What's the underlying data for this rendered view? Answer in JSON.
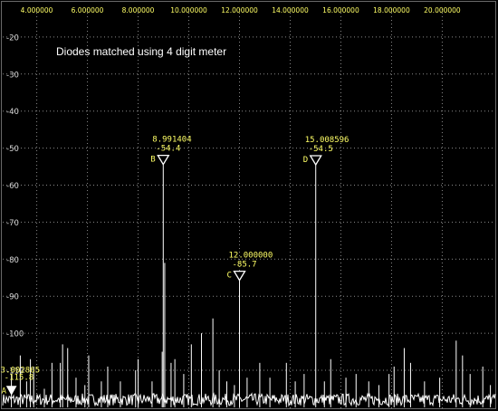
{
  "chart_data": {
    "type": "line",
    "title": "",
    "annotation": "Diodes matched using 4 digit meter",
    "xlabel": "",
    "ylabel": "",
    "xlim": [
      2.55,
      22.2
    ],
    "ylim": [
      -121,
      -10
    ],
    "x_ticks": [
      {
        "value": 4,
        "label": "4.000000"
      },
      {
        "value": 6,
        "label": "6.000000"
      },
      {
        "value": 8,
        "label": "8.000000"
      },
      {
        "value": 10,
        "label": "10.000000"
      },
      {
        "value": 12,
        "label": "12.000000"
      },
      {
        "value": 14,
        "label": "14.000000"
      },
      {
        "value": 16,
        "label": "16.000000"
      },
      {
        "value": 18,
        "label": "18.000000"
      },
      {
        "value": 20,
        "label": "20.000000"
      }
    ],
    "y_ticks": [
      {
        "value": -20,
        "label": "-20"
      },
      {
        "value": -30,
        "label": "-30"
      },
      {
        "value": -40,
        "label": "-40"
      },
      {
        "value": -50,
        "label": "-50"
      },
      {
        "value": -60,
        "label": "-60"
      },
      {
        "value": -70,
        "label": "-70"
      },
      {
        "value": -80,
        "label": "-80"
      },
      {
        "value": -90,
        "label": "-90"
      },
      {
        "value": -100,
        "label": "-100"
      },
      {
        "value": -110,
        "label": "-110"
      }
    ],
    "grid": true,
    "colors": {
      "background": "#000000",
      "trace": "#ffffff",
      "grid": "#8a8a8a",
      "tick_labels": "#ffff66",
      "markers": "#ffff66"
    },
    "noise_floor": -120,
    "peaks": [
      {
        "x": 3.0,
        "y": -111
      },
      {
        "x": 3.35,
        "y": -106
      },
      {
        "x": 3.6,
        "y": -113
      },
      {
        "x": 3.75,
        "y": -107
      },
      {
        "x": 3.88,
        "y": -109
      },
      {
        "x": 4.3,
        "y": -115
      },
      {
        "x": 4.6,
        "y": -108
      },
      {
        "x": 4.93,
        "y": -108
      },
      {
        "x": 5.02,
        "y": -103
      },
      {
        "x": 5.22,
        "y": -104
      },
      {
        "x": 5.55,
        "y": -112
      },
      {
        "x": 5.9,
        "y": -114
      },
      {
        "x": 6.05,
        "y": -106
      },
      {
        "x": 6.55,
        "y": -113
      },
      {
        "x": 6.8,
        "y": -109
      },
      {
        "x": 7.3,
        "y": -113
      },
      {
        "x": 7.9,
        "y": -110
      },
      {
        "x": 8.0,
        "y": -107
      },
      {
        "x": 8.55,
        "y": -113
      },
      {
        "x": 8.95,
        "y": -105
      },
      {
        "x": 8.991404,
        "y": -54.4
      },
      {
        "x": 9.05,
        "y": -81
      },
      {
        "x": 9.3,
        "y": -108
      },
      {
        "x": 9.45,
        "y": -107
      },
      {
        "x": 9.8,
        "y": -111
      },
      {
        "x": 10.1,
        "y": -103
      },
      {
        "x": 10.5,
        "y": -100
      },
      {
        "x": 10.95,
        "y": -96
      },
      {
        "x": 11.2,
        "y": -110
      },
      {
        "x": 11.5,
        "y": -113
      },
      {
        "x": 11.8,
        "y": -114
      },
      {
        "x": 12.0,
        "y": -85.7
      },
      {
        "x": 12.3,
        "y": -112
      },
      {
        "x": 12.8,
        "y": -108
      },
      {
        "x": 13.2,
        "y": -112
      },
      {
        "x": 13.85,
        "y": -108
      },
      {
        "x": 14.2,
        "y": -113
      },
      {
        "x": 14.55,
        "y": -111
      },
      {
        "x": 15.008596,
        "y": -54.5
      },
      {
        "x": 15.35,
        "y": -113
      },
      {
        "x": 15.6,
        "y": -107
      },
      {
        "x": 16.2,
        "y": -112
      },
      {
        "x": 16.6,
        "y": -111
      },
      {
        "x": 17.1,
        "y": -113
      },
      {
        "x": 17.5,
        "y": -114
      },
      {
        "x": 17.9,
        "y": -111
      },
      {
        "x": 18.1,
        "y": -109
      },
      {
        "x": 18.5,
        "y": -104
      },
      {
        "x": 18.75,
        "y": -108
      },
      {
        "x": 19.3,
        "y": -113
      },
      {
        "x": 19.9,
        "y": -112
      },
      {
        "x": 20.55,
        "y": -102
      },
      {
        "x": 20.8,
        "y": -106
      },
      {
        "x": 21.1,
        "y": -111
      },
      {
        "x": 21.6,
        "y": -109
      },
      {
        "x": 21.9,
        "y": -114
      }
    ],
    "markers": [
      {
        "id": "A",
        "freq": "3.002865",
        "level": "-115.8",
        "x": 3.002865,
        "y": -115.8
      },
      {
        "id": "B",
        "freq": "8.991404",
        "level": "-54.4",
        "x": 8.991404,
        "y": -54.4
      },
      {
        "id": "C",
        "freq": "12.000000",
        "level": "-85.7",
        "x": 12.0,
        "y": -85.7
      },
      {
        "id": "D",
        "freq": "15.008596",
        "level": "-54.5",
        "x": 15.008596,
        "y": -54.5
      }
    ]
  }
}
